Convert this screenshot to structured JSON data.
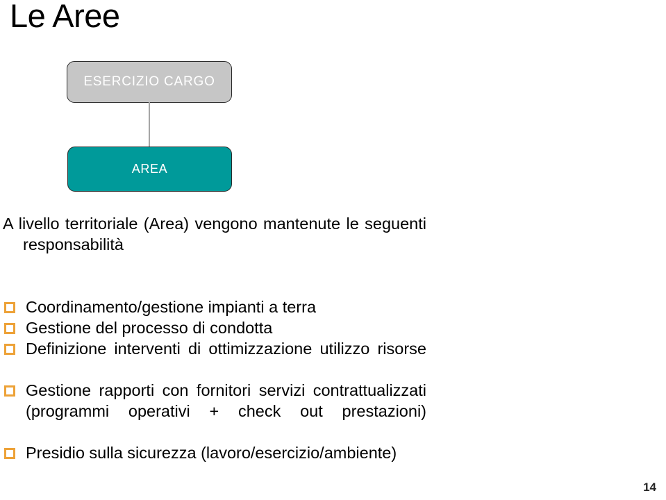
{
  "slide": {
    "title": "Le Aree",
    "page_number": "14"
  },
  "diagram": {
    "nodes": [
      {
        "id": "esercizio-cargo",
        "label": "ESERCIZIO CARGO",
        "fill": "#c6c6c6",
        "text_color": "#ffffff"
      },
      {
        "id": "area",
        "label": "AREA",
        "fill": "#009a9a",
        "text_color": "#ffffff"
      }
    ],
    "connector_color": "#a6a6a6"
  },
  "body": {
    "intro": "A livello territoriale (Area) vengono mantenute le seguenti responsabilità",
    "bullet_color": "#eda238",
    "bullets": [
      "Coordinamento/gestione impianti a terra",
      "Gestione del processo di condotta",
      "Definizione interventi di ottimizzazione utilizzo risorse",
      "Gestione rapporti con fornitori servizi contrattualizzati (programmi operativi + check out prestazioni)",
      "Presidio sulla sicurezza (lavoro/esercizio/ambiente)"
    ]
  }
}
